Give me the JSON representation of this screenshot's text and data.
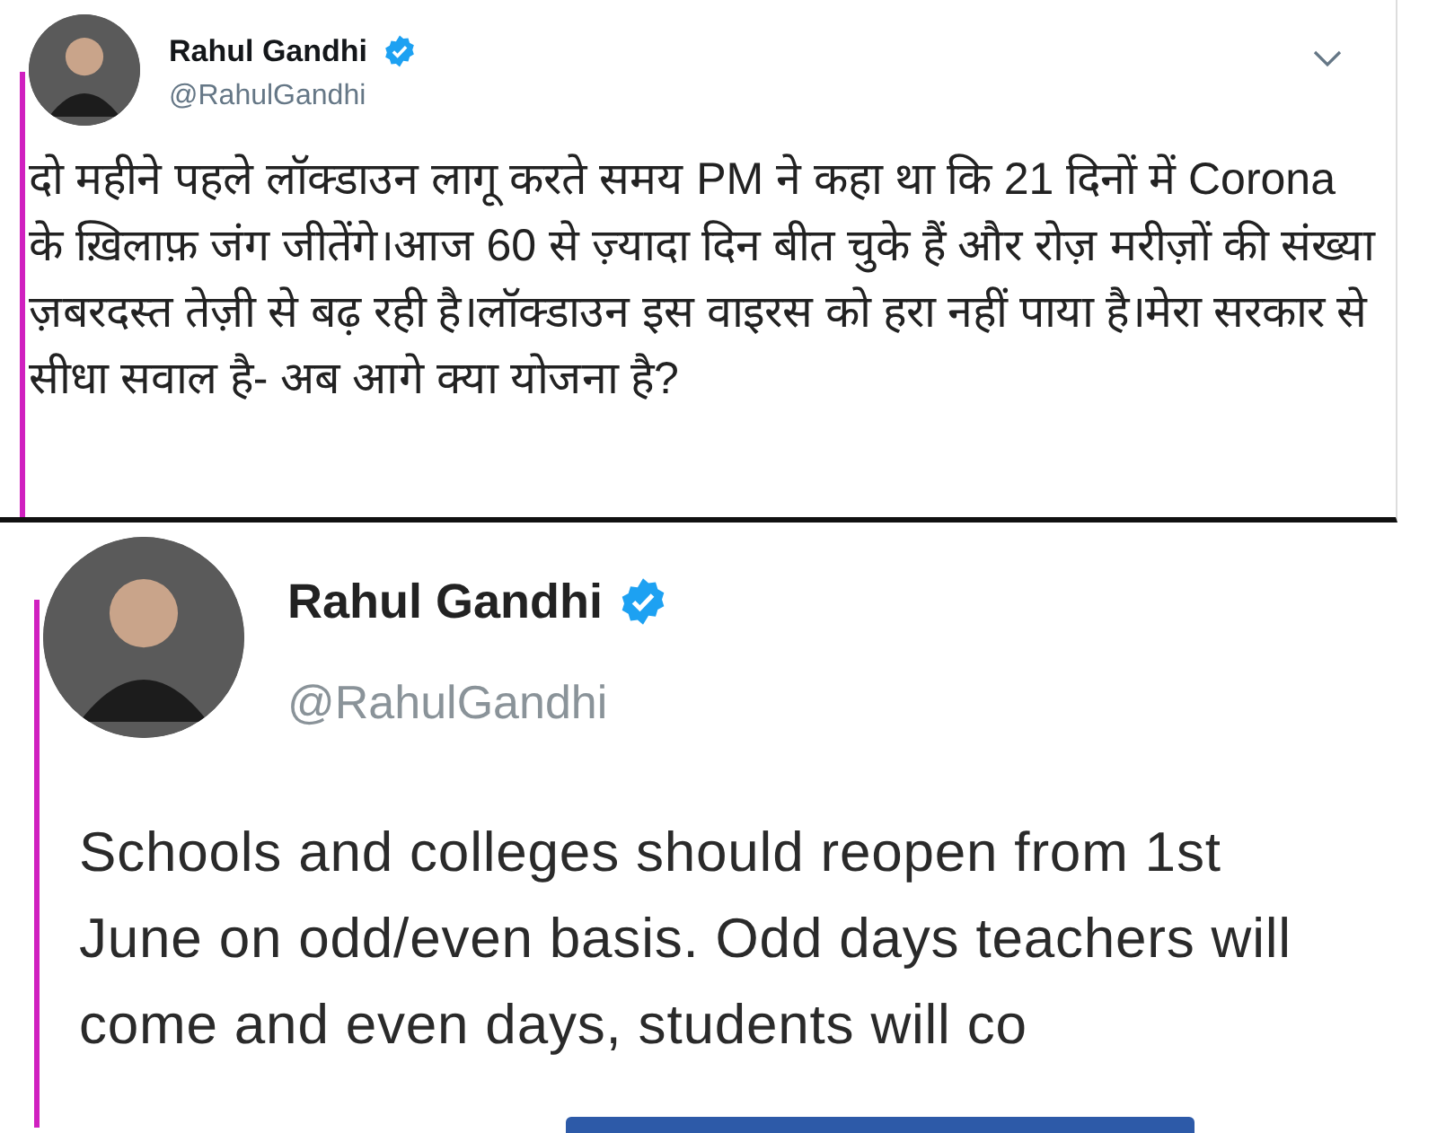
{
  "tweets": [
    {
      "name": "Rahul Gandhi",
      "verified": true,
      "handle": "@RahulGandhi",
      "text": "दो महीने पहले लॉक्डाउन लागू करते समय PM ने कहा था कि 21 दिनों में Corona के ख़िलाफ़ जंग जीतेंगे।आज 60 से ज़्यादा दिन बीत चुके हैं और रोज़ मरीज़ों की संख्या ज़बरदस्त तेज़ी से बढ़ रही है।लॉक्डाउन इस वाइरस को हरा नहीं पाया है।मेरा सरकार से सीधा सवाल है- अब आगे क्या योजना है?"
    },
    {
      "name": "Rahul Gandhi",
      "verified": true,
      "handle": "@RahulGandhi",
      "text": "Schools and colleges should reopen from 1st June on odd/even basis. Odd days teachers will come and even days, students will co"
    }
  ]
}
